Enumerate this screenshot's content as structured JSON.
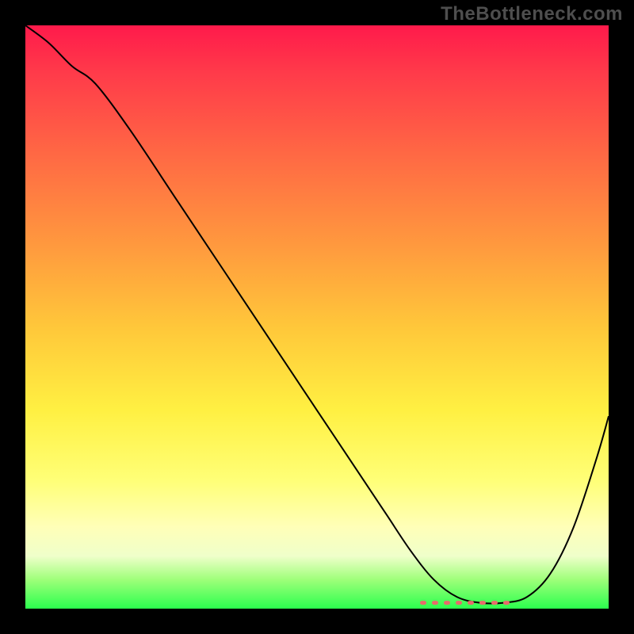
{
  "watermark": "TheBottleneck.com",
  "chart_data": {
    "type": "line",
    "title": "",
    "xlabel": "",
    "ylabel": "",
    "xlim": [
      0,
      100
    ],
    "ylim": [
      0,
      100
    ],
    "grid": false,
    "series": [
      {
        "name": "bottleneck-curve",
        "x": [
          0,
          4,
          8,
          12,
          18,
          26,
          34,
          42,
          50,
          58,
          62,
          66,
          70,
          74,
          78,
          82,
          86,
          90,
          94,
          98,
          100
        ],
        "values": [
          100,
          97,
          93,
          90,
          82,
          70,
          58,
          46,
          34,
          22,
          16,
          10,
          5,
          2,
          1,
          1,
          2,
          6,
          14,
          26,
          33
        ]
      }
    ],
    "annotations": [
      {
        "name": "optimal-flat-region",
        "x_start": 68,
        "x_end": 84,
        "y": 1
      }
    ],
    "background_gradient": {
      "direction": "vertical",
      "stops": [
        {
          "pos": 0.0,
          "color": "#ff1a4b"
        },
        {
          "pos": 0.5,
          "color": "#ffc83a"
        },
        {
          "pos": 0.8,
          "color": "#ffff77"
        },
        {
          "pos": 1.0,
          "color": "#2bff4e"
        }
      ]
    }
  }
}
